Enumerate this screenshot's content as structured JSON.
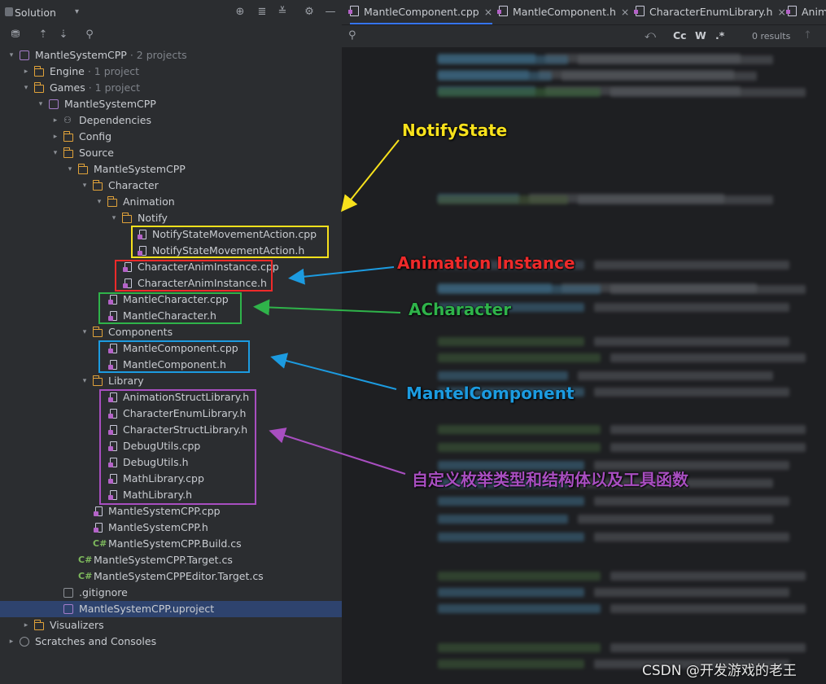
{
  "sidebar": {
    "title": "Solution",
    "header_icons": [
      "crosshair-icon",
      "collapse-all-icon",
      "expand-all-icon",
      "gear-icon",
      "minimize-icon"
    ],
    "toolbar_icons": [
      "filter-icon",
      "scroll-from-source-icon",
      "scroll-to-source-icon",
      "search-icon"
    ]
  },
  "tree": [
    {
      "label": "MantleSystemCPP",
      "muted": " · 2 projects",
      "depth": 0,
      "arrow": "▾",
      "icon": "proj",
      "name": "tree-solution-root"
    },
    {
      "label": "Engine",
      "muted": " · 1 project",
      "depth": 1,
      "arrow": "▸",
      "icon": "folder",
      "name": "tree-engine"
    },
    {
      "label": "Games",
      "muted": " · 1 project",
      "depth": 1,
      "arrow": "▾",
      "icon": "folder",
      "name": "tree-games"
    },
    {
      "label": "MantleSystemCPP",
      "muted": "",
      "depth": 2,
      "arrow": "▾",
      "icon": "proj",
      "name": "tree-project"
    },
    {
      "label": "Dependencies",
      "muted": "",
      "depth": 3,
      "arrow": "▸",
      "icon": "deps",
      "name": "tree-dependencies"
    },
    {
      "label": "Config",
      "muted": "",
      "depth": 3,
      "arrow": "▸",
      "icon": "folder",
      "name": "tree-config"
    },
    {
      "label": "Source",
      "muted": "",
      "depth": 3,
      "arrow": "▾",
      "icon": "folder",
      "name": "tree-source"
    },
    {
      "label": "MantleSystemCPP",
      "muted": "",
      "depth": 4,
      "arrow": "▾",
      "icon": "folder",
      "name": "tree-source-module"
    },
    {
      "label": "Character",
      "muted": "",
      "depth": 5,
      "arrow": "▾",
      "icon": "folder",
      "name": "tree-character"
    },
    {
      "label": "Animation",
      "muted": "",
      "depth": 6,
      "arrow": "▾",
      "icon": "folder",
      "name": "tree-animation"
    },
    {
      "label": "Notify",
      "muted": "",
      "depth": 7,
      "arrow": "▾",
      "icon": "folder",
      "name": "tree-notify"
    },
    {
      "label": "NotifyStateMovementAction.cpp",
      "muted": "",
      "depth": 8,
      "arrow": "",
      "icon": "file",
      "name": "tree-file"
    },
    {
      "label": "NotifyStateMovementAction.h",
      "muted": "",
      "depth": 8,
      "arrow": "",
      "icon": "file",
      "name": "tree-file"
    },
    {
      "label": "CharacterAnimInstance.cpp",
      "muted": "",
      "depth": 7,
      "arrow": "",
      "icon": "file",
      "name": "tree-file"
    },
    {
      "label": "CharacterAnimInstance.h",
      "muted": "",
      "depth": 7,
      "arrow": "",
      "icon": "file",
      "name": "tree-file"
    },
    {
      "label": "MantleCharacter.cpp",
      "muted": "",
      "depth": 6,
      "arrow": "",
      "icon": "file",
      "name": "tree-file"
    },
    {
      "label": "MantleCharacter.h",
      "muted": "",
      "depth": 6,
      "arrow": "",
      "icon": "file",
      "name": "tree-file"
    },
    {
      "label": "Components",
      "muted": "",
      "depth": 5,
      "arrow": "▾",
      "icon": "folder",
      "name": "tree-components"
    },
    {
      "label": "MantleComponent.cpp",
      "muted": "",
      "depth": 6,
      "arrow": "",
      "icon": "file",
      "name": "tree-file"
    },
    {
      "label": "MantleComponent.h",
      "muted": "",
      "depth": 6,
      "arrow": "",
      "icon": "file",
      "name": "tree-file"
    },
    {
      "label": "Library",
      "muted": "",
      "depth": 5,
      "arrow": "▾",
      "icon": "folder",
      "name": "tree-library"
    },
    {
      "label": "AnimationStructLibrary.h",
      "muted": "",
      "depth": 6,
      "arrow": "",
      "icon": "file",
      "name": "tree-file"
    },
    {
      "label": "CharacterEnumLibrary.h",
      "muted": "",
      "depth": 6,
      "arrow": "",
      "icon": "file",
      "name": "tree-file"
    },
    {
      "label": "CharacterStructLibrary.h",
      "muted": "",
      "depth": 6,
      "arrow": "",
      "icon": "file",
      "name": "tree-file"
    },
    {
      "label": "DebugUtils.cpp",
      "muted": "",
      "depth": 6,
      "arrow": "",
      "icon": "file",
      "name": "tree-file"
    },
    {
      "label": "DebugUtils.h",
      "muted": "",
      "depth": 6,
      "arrow": "",
      "icon": "file",
      "name": "tree-file"
    },
    {
      "label": "MathLibrary.cpp",
      "muted": "",
      "depth": 6,
      "arrow": "",
      "icon": "file",
      "name": "tree-file"
    },
    {
      "label": "MathLibrary.h",
      "muted": "",
      "depth": 6,
      "arrow": "",
      "icon": "file",
      "name": "tree-file"
    },
    {
      "label": "MantleSystemCPP.cpp",
      "muted": "",
      "depth": 5,
      "arrow": "",
      "icon": "file",
      "name": "tree-file"
    },
    {
      "label": "MantleSystemCPP.h",
      "muted": "",
      "depth": 5,
      "arrow": "",
      "icon": "file",
      "name": "tree-file"
    },
    {
      "label": "MantleSystemCPP.Build.cs",
      "muted": "",
      "depth": 5,
      "arrow": "",
      "icon": "cs",
      "name": "tree-file"
    },
    {
      "label": "MantleSystemCPP.Target.cs",
      "muted": "",
      "depth": 4,
      "arrow": "",
      "icon": "cs",
      "name": "tree-file"
    },
    {
      "label": "MantleSystemCPPEditor.Target.cs",
      "muted": "",
      "depth": 4,
      "arrow": "",
      "icon": "cs",
      "name": "tree-file"
    },
    {
      "label": ".gitignore",
      "muted": "",
      "depth": 3,
      "arrow": "",
      "icon": "git",
      "name": "tree-file"
    },
    {
      "label": "MantleSystemCPP.uproject",
      "muted": "",
      "depth": 3,
      "arrow": "",
      "icon": "proj",
      "name": "tree-file-selected",
      "selected": true
    },
    {
      "label": "Visualizers",
      "muted": "",
      "depth": 1,
      "arrow": "▸",
      "icon": "folder",
      "name": "tree-visualizers"
    },
    {
      "label": "Scratches and Consoles",
      "muted": "",
      "depth": 0,
      "arrow": "▸",
      "icon": "scratch",
      "name": "tree-scratches"
    }
  ],
  "editor": {
    "tabs": [
      {
        "label": "MantleComponent.cpp",
        "close": "×",
        "active": true
      },
      {
        "label": "MantleComponent.h",
        "close": "×",
        "active": false
      },
      {
        "label": "CharacterEnumLibrary.h",
        "close": "×",
        "active": false
      },
      {
        "label": "Anim",
        "close": "",
        "active": false
      }
    ],
    "find": {
      "case_label": "Cc",
      "word_label": "W",
      "regex_label": ".*",
      "results": "0 results"
    }
  },
  "annotations": {
    "notify_state": "NotifyState",
    "anim_instance": "Animation Instance",
    "character": "ACharacter",
    "component": "MantelComponent",
    "library": "自定义枚举类型和结构体以及工具函数",
    "colors": {
      "yellow": "#f7e11c",
      "red": "#ee2a2a",
      "green": "#2fb34a",
      "blue": "#1c9be0",
      "purple": "#a84ec0"
    }
  },
  "watermark": "CSDN @开发游戏的老王"
}
